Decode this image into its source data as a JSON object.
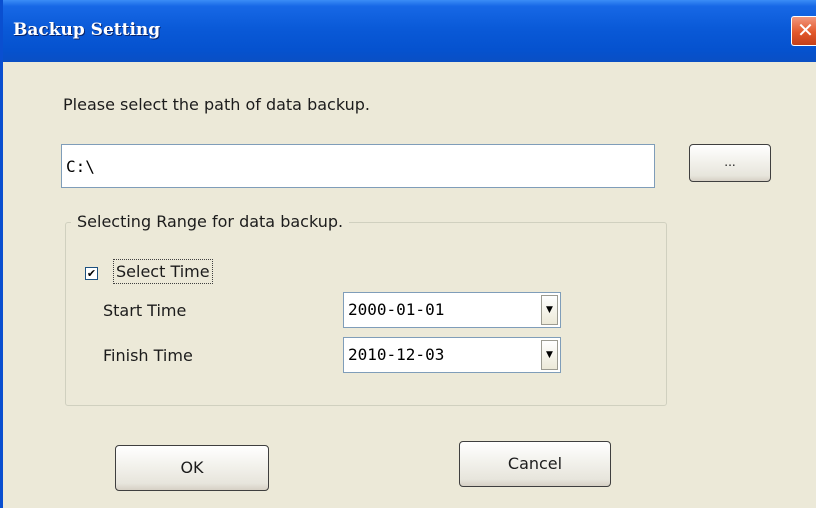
{
  "window": {
    "title": "Backup Setting",
    "close_glyph": "✕"
  },
  "path_section": {
    "prompt": "Please select the path of data backup.",
    "path_value": "C:\\",
    "browse_label": "..."
  },
  "range_group": {
    "legend": "Selecting Range for data backup.",
    "select_time_label": "Select Time",
    "select_time_checked": true,
    "check_glyph": "✔",
    "start_time_label": "Start Time",
    "start_time_value": "2000-01-01",
    "finish_time_label": "Finish Time",
    "finish_time_value": "2010-12-03",
    "dropdown_glyph": "▼"
  },
  "actions": {
    "ok_label": "OK",
    "cancel_label": "Cancel"
  },
  "colors": {
    "titlebar": "#0a5ad8",
    "dialog_background": "#ece9d8",
    "close_button": "#e2582b"
  }
}
